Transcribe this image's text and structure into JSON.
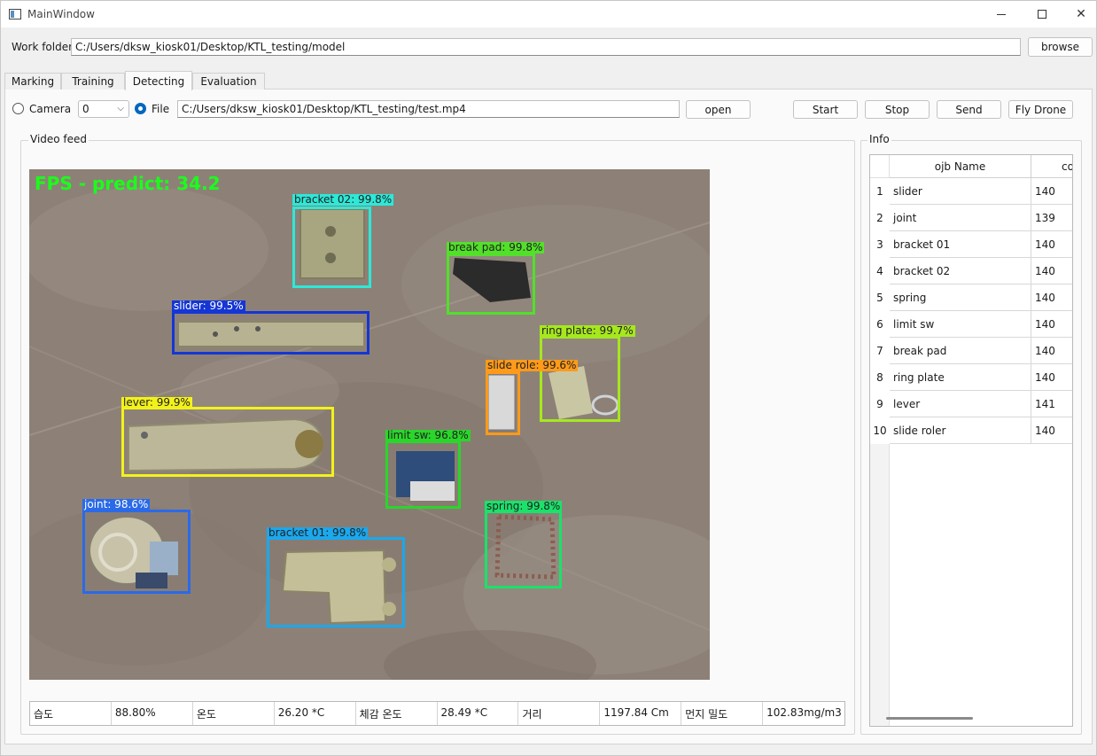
{
  "window": {
    "title": "MainWindow"
  },
  "work_folder": {
    "label": "Work folder",
    "path": "C:/Users/dksw_kiosk01/Desktop/KTL_testing/model",
    "browse_label": "browse"
  },
  "tabs": [
    "Marking",
    "Training",
    "Detecting",
    "Evaluation"
  ],
  "active_tab": "Detecting",
  "source": {
    "camera_label": "Camera",
    "camera_index": "0",
    "file_label": "File",
    "file_path": "C:/Users/dksw_kiosk01/Desktop/KTL_testing/test.mp4",
    "selected": "File",
    "open_label": "open"
  },
  "actions": {
    "start": "Start",
    "stop": "Stop",
    "send": "Send",
    "fly_drone": "Fly Drone"
  },
  "video": {
    "group_title": "Video feed",
    "fps_overlay": "FPS - predict: 34.2",
    "detections": [
      {
        "label": "bracket 02: 99.8%",
        "color": "#2ee8d8"
      },
      {
        "label": "break pad: 99.8%",
        "color": "#52e02a"
      },
      {
        "label": "slider: 99.5%",
        "color": "#1436d4"
      },
      {
        "label": "ring plate: 99.7%",
        "color": "#a6e81e"
      },
      {
        "label": "slide role: 99.6%",
        "color": "#ff9a1a"
      },
      {
        "label": "lever: 99.9%",
        "color": "#f2f21a"
      },
      {
        "label": "limit sw: 96.8%",
        "color": "#2ad62a"
      },
      {
        "label": "spring: 99.8%",
        "color": "#1ae26a"
      },
      {
        "label": "joint: 98.6%",
        "color": "#2a6ae8"
      },
      {
        "label": "bracket 01: 99.8%",
        "color": "#1aa8ee"
      }
    ]
  },
  "sensors": [
    {
      "name": "습도",
      "value": "88.80%"
    },
    {
      "name": "온도",
      "value": "26.20 *C"
    },
    {
      "name": "체감 온도",
      "value": "28.49 *C"
    },
    {
      "name": "거리",
      "value": "1197.84 Cm"
    },
    {
      "name": "먼지 밀도",
      "value": "102.83mg/m3"
    }
  ],
  "info": {
    "group_title": "Info",
    "columns": [
      "ojb Name",
      "co"
    ],
    "rows": [
      {
        "num": "1",
        "name": "slider",
        "count": "140"
      },
      {
        "num": "2",
        "name": "joint",
        "count": "139"
      },
      {
        "num": "3",
        "name": "bracket 01",
        "count": "140"
      },
      {
        "num": "4",
        "name": "bracket 02",
        "count": "140"
      },
      {
        "num": "5",
        "name": "spring",
        "count": "140"
      },
      {
        "num": "6",
        "name": "limit sw",
        "count": "140"
      },
      {
        "num": "7",
        "name": "break pad",
        "count": "140"
      },
      {
        "num": "8",
        "name": "ring plate",
        "count": "140"
      },
      {
        "num": "9",
        "name": "lever",
        "count": "141"
      },
      {
        "num": "10",
        "name": "slide roler",
        "count": "140"
      }
    ]
  }
}
